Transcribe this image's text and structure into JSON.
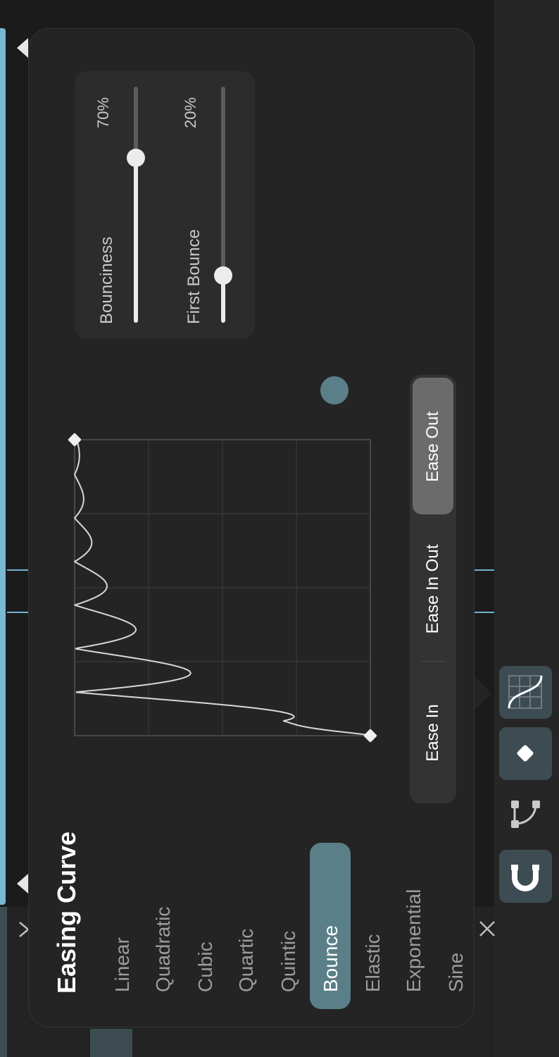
{
  "panel": {
    "title": "Easing Curve",
    "curve_types": [
      "Linear",
      "Quadratic",
      "Cubic",
      "Quartic",
      "Quintic",
      "Bounce",
      "Elastic",
      "Exponential",
      "Sine"
    ],
    "selected_curve": "Bounce"
  },
  "sliders": [
    {
      "label": "Bounciness",
      "value_text": "70%",
      "value": 70
    },
    {
      "label": "First Bounce",
      "value_text": "20%",
      "value": 20
    }
  ],
  "ease_modes": {
    "options": [
      "Ease In",
      "Ease In Out",
      "Ease Out"
    ],
    "selected": "Ease Out"
  },
  "toolbar": {
    "buttons": [
      {
        "icon": "easing-curve-icon",
        "active": true
      },
      {
        "icon": "keyframe-diamond-icon",
        "active": true
      },
      {
        "icon": "bezier-path-icon",
        "active": false
      },
      {
        "icon": "magnet-icon",
        "active": true
      }
    ]
  },
  "colors": {
    "accent": "#5a7f88",
    "panel_bg": "#242424",
    "timeline_line": "#6fb3cf"
  }
}
